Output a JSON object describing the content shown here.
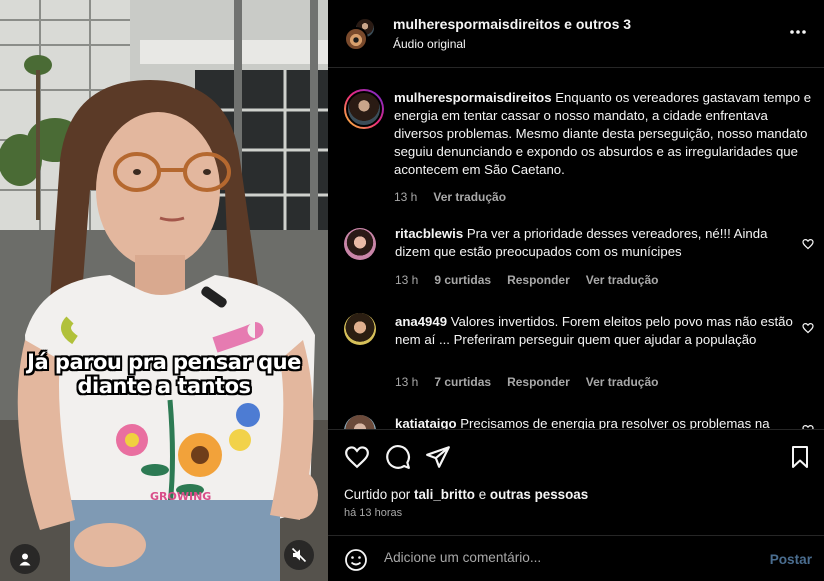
{
  "video": {
    "caption_line1": "Já parou pra pensar que",
    "caption_line2": "diante a tantos",
    "user_icon": "user-icon",
    "mute_icon": "speaker-muted-icon"
  },
  "header": {
    "account": "mulherespormaisdireitos",
    "others": "e outros 3",
    "audio": "Áudio original",
    "more_icon": "more-horizontal-icon"
  },
  "caption_post": {
    "user": "mulherespormaisdireitos",
    "text": "Enquanto os vereadores gastavam tempo e energia em tentar cassar o nosso mandato, a cidade enfrentava diversos problemas. Mesmo diante desta perseguição, nosso mandato seguiu denunciando e expondo os absurdos e as irregularidades que acontecem em São Caetano.",
    "time": "13 h",
    "translate": "Ver tradução"
  },
  "comments": [
    {
      "user": "ritacblewis",
      "text": "Pra ver a prioridade desses vereadores, né!!! Ainda dizem que estão preocupados com os munícipes",
      "time": "13 h",
      "likes": "9 curtidas",
      "reply": "Responder",
      "translate": "Ver tradução"
    },
    {
      "user": "ana4949",
      "text": "Valores invertidos. Forem eleitos pelo povo mas não estão nem aí ... Preferiram perseguir quem quer ajudar a população",
      "time": "13 h",
      "likes": "7 curtidas",
      "reply": "Responder",
      "translate": "Ver tradução"
    },
    {
      "user": "katiataigo",
      "text": "Precisamos de energia pra resolver os problemas na"
    }
  ],
  "actions": {
    "like_icon": "heart-icon",
    "comment_icon": "comment-icon",
    "share_icon": "send-icon",
    "save_icon": "bookmark-icon"
  },
  "likes": {
    "prefix": "Curtido por",
    "user": "tali_britto",
    "joiner": "e",
    "others": "outras pessoas"
  },
  "posted_ago": "há 13 horas",
  "composer": {
    "emoji_icon": "emoji-icon",
    "placeholder": "Adicione um comentário...",
    "post_label": "Postar"
  },
  "colors": {
    "background": "#000000",
    "text": "#f5f5f5",
    "muted": "#a8a8a8",
    "divider": "#262626",
    "post_disabled": "#4a6d8f"
  }
}
